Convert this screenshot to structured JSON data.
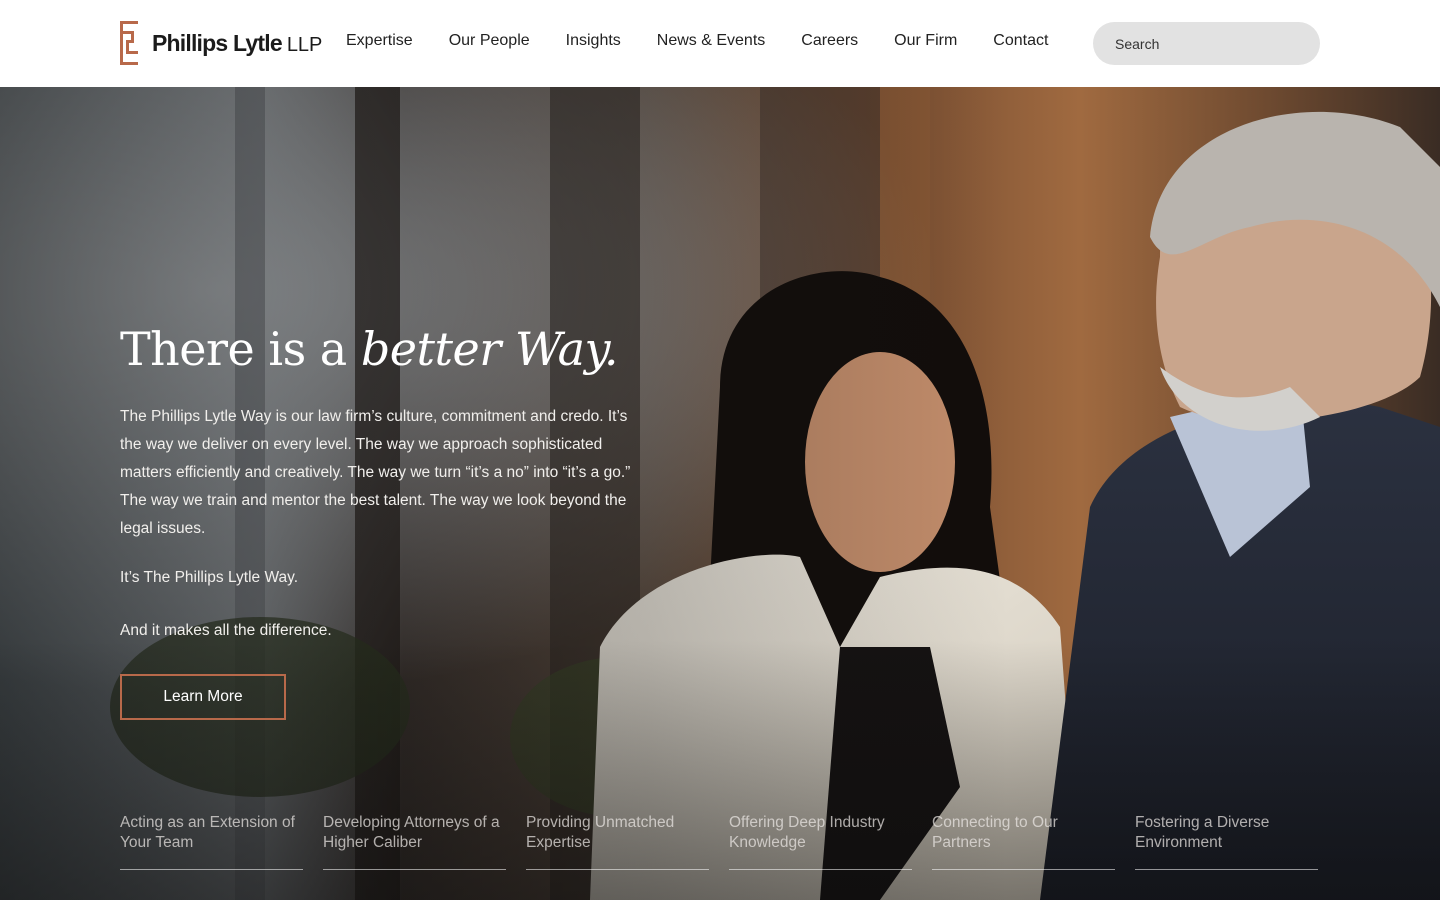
{
  "brand": {
    "name": "Phillips Lytle",
    "suffix": "LLP",
    "accent": "#b8694a"
  },
  "nav": {
    "items": [
      {
        "label": "Expertise"
      },
      {
        "label": "Our People"
      },
      {
        "label": "Insights"
      },
      {
        "label": "News & Events"
      },
      {
        "label": "Careers"
      },
      {
        "label": "Our Firm"
      },
      {
        "label": "Contact"
      }
    ]
  },
  "search": {
    "placeholder": "Search"
  },
  "hero": {
    "headline_prefix": "There is a ",
    "headline_emphasis": "better Way.",
    "body": "The Phillips Lytle Way is our law firm’s culture, commitment and credo. It’s the way we deliver on every level. The way we approach sophisticated matters efficiently and creatively. The way we turn “it’s a no” into “it’s a go.” The way we train and mentor the best talent. The way we look beyond the legal issues.",
    "line2": "It’s The Phillips Lytle Way.",
    "line3": "And it makes all the difference.",
    "cta_label": "Learn More"
  },
  "pillars": [
    {
      "label": "Acting as an Extension of Your Team"
    },
    {
      "label": "Developing Attorneys of a Higher Caliber"
    },
    {
      "label": "Providing Unmatched Expertise"
    },
    {
      "label": "Offering Deep Industry Knowledge"
    },
    {
      "label": "Connecting to Our Partners"
    },
    {
      "label": "Fostering a Diverse Environment"
    }
  ]
}
